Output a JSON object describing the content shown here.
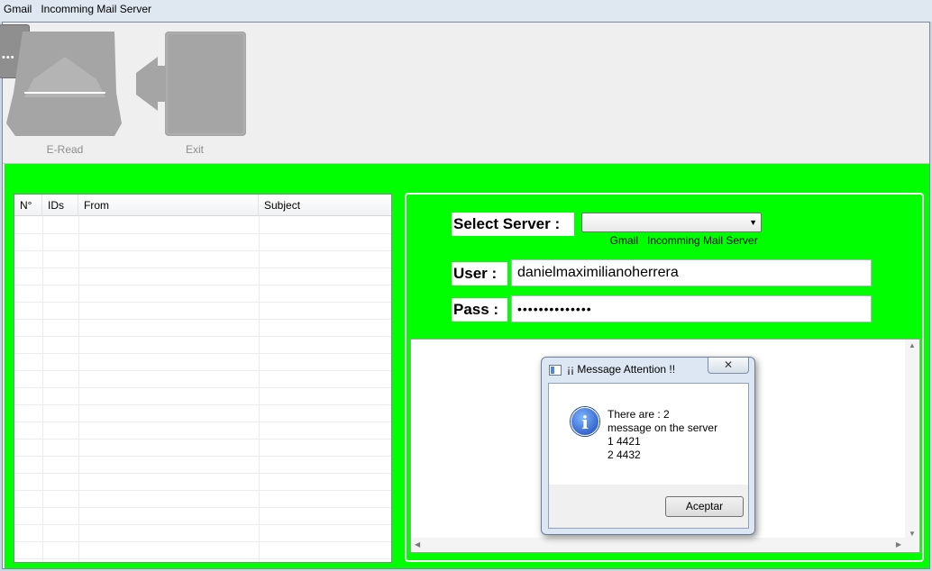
{
  "window": {
    "title": "Gmail   Incomming Mail Server"
  },
  "toolbar": {
    "read_label": "E-Read",
    "exit_label": "Exit"
  },
  "table": {
    "columns": [
      "N°",
      "IDs",
      "From",
      "Subject"
    ],
    "rows": []
  },
  "form": {
    "server_label": "Select Server :",
    "server_value": "Gmail   Incomming Mail Server",
    "user_label": "User :",
    "user_value": "danielmaximilianoherrera",
    "pass_label": "Pass :",
    "pass_value": "••••••••••••••"
  },
  "dialog": {
    "title": "¡¡ Message Attention !!",
    "close_symbol": "✕",
    "lines": [
      "There are : 2",
      "message on the server",
      "1 4421",
      "2 4432"
    ],
    "ok_label": "Aceptar"
  },
  "colors": {
    "accent": "#00ff00",
    "icon_gray": "#a3a3a3"
  }
}
